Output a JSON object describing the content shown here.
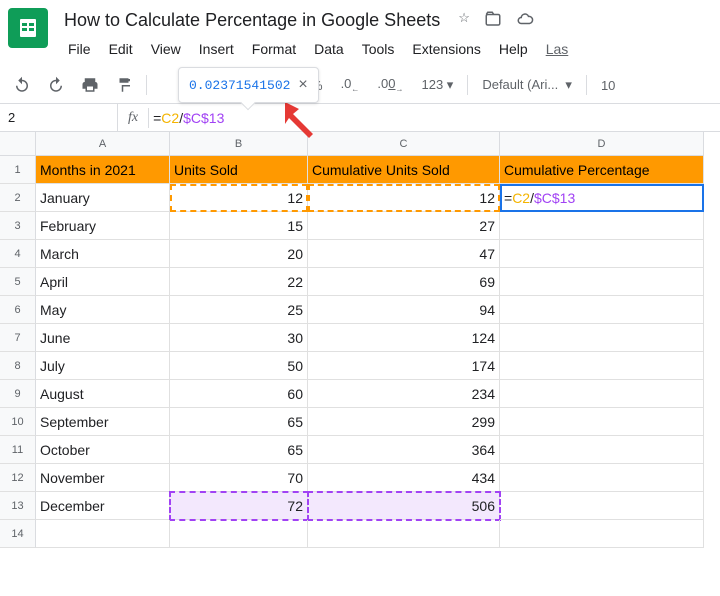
{
  "doc": {
    "title": "How to Calculate Percentage in Google Sheets"
  },
  "menu": {
    "file": "File",
    "edit": "Edit",
    "view": "View",
    "insert": "Insert",
    "format": "Format",
    "data": "Data",
    "tools": "Tools",
    "extensions": "Extensions",
    "help": "Help",
    "last": "Las"
  },
  "toolbar": {
    "percent": "%",
    "dec1": ".0",
    "dec2": ".00",
    "more": "123",
    "font": "Default (Ari...",
    "size": "10"
  },
  "tooltip": {
    "value": "0.02371541502"
  },
  "namebox": {
    "value": "2"
  },
  "formula": {
    "eq": "=",
    "ref1": "C2",
    "op": "/",
    "ref2": "$C$13"
  },
  "cols": {
    "A": "A",
    "B": "B",
    "C": "C",
    "D": "D"
  },
  "rowlabels": [
    "1",
    "2",
    "3",
    "4",
    "5",
    "6",
    "7",
    "8",
    "9",
    "10",
    "11",
    "12",
    "13",
    "14"
  ],
  "headers": {
    "A": "Months in 2021",
    "B": "Units Sold",
    "C": "Cumulative Units Sold",
    "D": "Cumulative Percentage"
  },
  "d2": {
    "eq": "=",
    "r1": "C2",
    "op": "/",
    "r2": "$C$13"
  },
  "rows": [
    {
      "A": "January",
      "B": "12",
      "C": "12"
    },
    {
      "A": "February",
      "B": "15",
      "C": "27"
    },
    {
      "A": "March",
      "B": "20",
      "C": "47"
    },
    {
      "A": "April",
      "B": "22",
      "C": "69"
    },
    {
      "A": "May",
      "B": "25",
      "C": "94"
    },
    {
      "A": "June",
      "B": "30",
      "C": "124"
    },
    {
      "A": "July",
      "B": "50",
      "C": "174"
    },
    {
      "A": "August",
      "B": "60",
      "C": "234"
    },
    {
      "A": "September",
      "B": "65",
      "C": "299"
    },
    {
      "A": "October",
      "B": "65",
      "C": "364"
    },
    {
      "A": "November",
      "B": "70",
      "C": "434"
    },
    {
      "A": "December",
      "B": "72",
      "C": "506"
    }
  ]
}
